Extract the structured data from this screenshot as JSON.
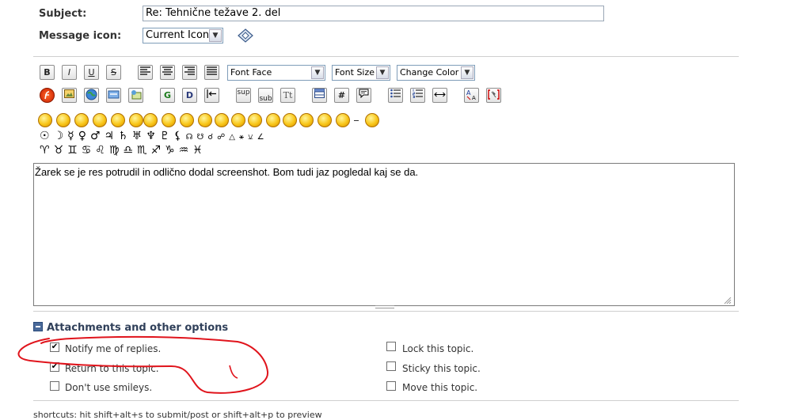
{
  "form": {
    "subject_label": "Subject:",
    "subject_value": "Re: Tehnične težave 2. del",
    "icon_label": "Message icon:",
    "icon_select": "Current Icon"
  },
  "toolbar": {
    "bold": "B",
    "italic": "I",
    "underline": "U",
    "strike": "S",
    "font_face": "Font Face",
    "font_size": "Font Size",
    "change_color": "Change Color",
    "glow": "G",
    "shadow": "D",
    "sup": "sup",
    "sub": "sub",
    "tt": "Tt",
    "hash": "#"
  },
  "symbols_row1": [
    "☉",
    "☽",
    "☿",
    "♀",
    "♂",
    "♃",
    "♄",
    "♅",
    "♆",
    "♇",
    "⚸",
    "☊",
    "☋",
    "☌",
    "☍",
    "△",
    "⚹",
    "⚺",
    "∠"
  ],
  "symbols_row2": [
    "♈",
    "♉",
    "♊",
    "♋",
    "♌",
    "♍",
    "♎",
    "♏",
    "♐",
    "♑",
    "♒",
    "♓"
  ],
  "editor": {
    "text": "Žarek se je res potrudil in odlično dodal screenshot.  Bom tudi jaz pogledal kaj se da."
  },
  "attachments": {
    "title": "Attachments and other options",
    "notify": "Notify me of replies.",
    "return": "Return to this topic.",
    "no_smileys": "Don't use smileys.",
    "lock": "Lock this topic.",
    "sticky": "Sticky this topic.",
    "move": "Move this topic.",
    "notify_checked": true,
    "return_checked": true
  },
  "shortcuts": "shortcuts: hit shift+alt+s to submit/post or shift+alt+p to preview",
  "colors": {
    "annotation_red": "#e0141c",
    "section_title": "#30405a"
  }
}
